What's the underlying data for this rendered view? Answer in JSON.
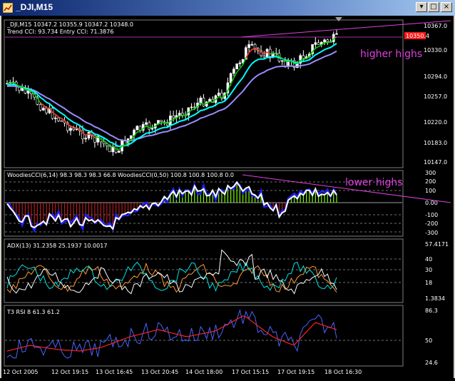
{
  "window": {
    "title": "_DJI,M15",
    "buttons": {
      "minimize": "▾",
      "restore": "□",
      "close": "×"
    }
  },
  "colors": {
    "background": "#000000",
    "up_candle": "#ffffff",
    "down_candle": "#ffffff",
    "ma_fast": "#00cc00",
    "ma_mid": "#00ffff",
    "ma_slow": "#9a8cff",
    "signal": "#ff3030",
    "trendline": "#e040e0",
    "annotation": "#e040e0",
    "cci_hist": "#7cfc00",
    "cci_line": "#ffffff",
    "cci_fast": "#2020ff",
    "adx_main": "#ffffff",
    "adx_plus": "#00e5e5",
    "adx_minus": "#ff9933",
    "rsi_line": "#ff2020",
    "rsi_fast": "#4466ff"
  },
  "panes": {
    "price": {
      "label_line1": "_DJI,M15  10347.2 10355.9 10347.2 10348.0",
      "label_line2": "Trend CCI: 93.734 Entry CCI: 71.3876",
      "annotation": "higher highs",
      "ticks": [
        "10367.0",
        "10330.0",
        "10294.0",
        "10257.0",
        "10220.0",
        "10183.0",
        "10147.0"
      ],
      "current_price": "10350.4"
    },
    "cci": {
      "label": "WoodiesCCI(6,14) 98.3 98.3 98.3 66.8  WoodiesCCI(0,50) 100.8 100.8 100.8 0.0",
      "annotation": "lower highs",
      "ticks": [
        "300",
        "200",
        "100",
        "0.00",
        "-100",
        "-200",
        "-300"
      ]
    },
    "adx": {
      "label": "ADX(13) 31.2358 25.1937 10.0017",
      "ticks": [
        "57.4171",
        "40",
        "30",
        "18",
        "1.3834"
      ]
    },
    "rsi": {
      "label": "T3 RSI 8 61.3 61.2",
      "ticks": [
        "86.3",
        "50",
        "24.6"
      ]
    }
  },
  "time_axis": [
    "12 Oct 2005",
    "12 Oct 19:15",
    "13 Oct 16:45",
    "13 Oct 20:45",
    "14 Oct 18:00",
    "17 Oct 15:15",
    "17 Oct 19:15",
    "18 Oct 16:30"
  ]
}
